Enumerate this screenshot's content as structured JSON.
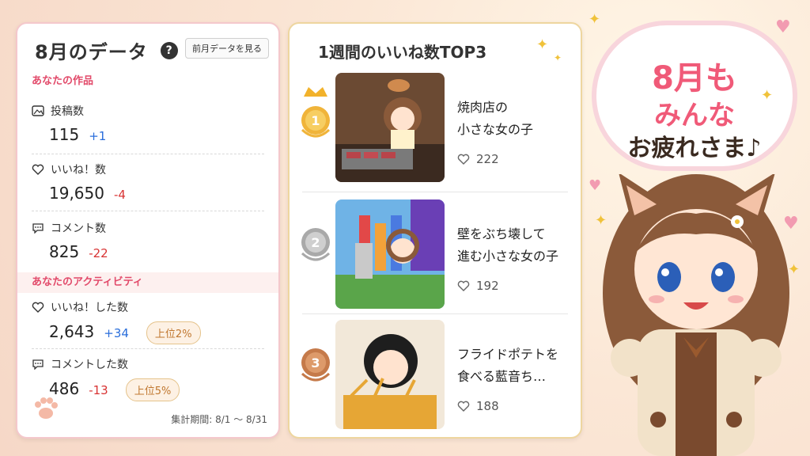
{
  "left": {
    "title": "8月のデータ",
    "prev_button": "前月データを見る",
    "section_works": "あなたの作品",
    "section_activity": "あなたのアクティビティ",
    "stats": [
      {
        "label": "投稿数",
        "value": "115",
        "delta": "+1"
      },
      {
        "label": "いいね！数",
        "value": "19,650",
        "delta": "-4"
      },
      {
        "label": "コメント数",
        "value": "825",
        "delta": "-22"
      }
    ],
    "activity": [
      {
        "label": "いいね！した数",
        "value": "2,643",
        "delta": "+34",
        "badge": "上位2%"
      },
      {
        "label": "コメントした数",
        "value": "486",
        "delta": "-13",
        "badge": "上位5%"
      }
    ],
    "period": "集計期間: 8/1 〜 8/31"
  },
  "middle": {
    "title": "1週間のいいね数TOP3",
    "items": [
      {
        "rank": "1",
        "title_line1": "焼肉店の",
        "title_line2": "小さな女の子",
        "likes": "222"
      },
      {
        "rank": "2",
        "title_line1": "壁をぶち壊して",
        "title_line2": "進む小さな女の子",
        "likes": "192"
      },
      {
        "rank": "3",
        "title_line1": "フライドポテトを",
        "title_line2": "食べる藍音ち…",
        "likes": "188"
      }
    ]
  },
  "bubble": {
    "line1": "8月も",
    "line2": "みんな",
    "line3": "お疲れさま♪"
  },
  "colors": {
    "accent_pink": "#f05a78",
    "delta_up": "#2a6edb",
    "delta_down": "#d83333"
  }
}
